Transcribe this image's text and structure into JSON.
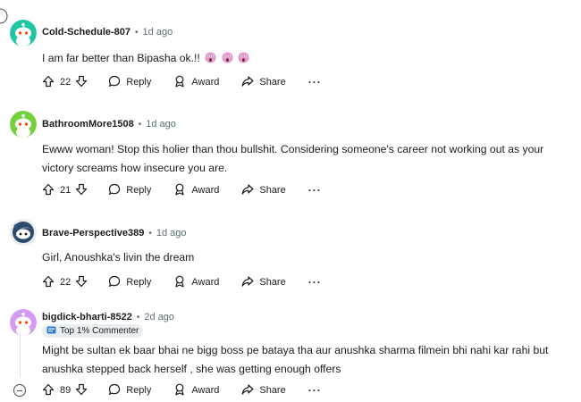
{
  "comments": [
    {
      "username": "Cold-Schedule-807",
      "time": "1d ago",
      "avatar_color": "#1fc6a6",
      "text": "I am far better than Bipasha ok.!!",
      "emojis": [
        "scream-emoji",
        "scream-emoji",
        "scream-emoji"
      ],
      "votes": "22",
      "actions": {
        "reply": "Reply",
        "award": "Award",
        "share": "Share",
        "more": "···"
      }
    },
    {
      "username": "BathroomMore1508",
      "time": "1d ago",
      "avatar_color": "#73d13d",
      "text": "Ewww woman! Stop this holier than thou bullshit. Considering someone's career not working out as your victory screams how insecure you are.",
      "votes": "21",
      "actions": {
        "reply": "Reply",
        "award": "Award",
        "share": "Share",
        "more": "···"
      }
    },
    {
      "username": "Brave-Perspective389",
      "time": "1d ago",
      "avatar_color": "#2b4a6b",
      "text": "Girl, Anoushka's livin the dream",
      "votes": "22",
      "actions": {
        "reply": "Reply",
        "award": "Award",
        "share": "Share",
        "more": "···"
      }
    },
    {
      "username": "bigdick-bharti-8522",
      "time": "2d ago",
      "avatar_color": "#d49bf3",
      "badge": "Top 1% Commenter",
      "text": "Might be sultan ek baar bhai ne bigg boss pe bataya tha aur anushka sharma filmein bhi nahi kar rahi but anushka stepped back herself , she was getting enough offers",
      "votes": "89",
      "actions": {
        "reply": "Reply",
        "award": "Award",
        "share": "Share",
        "more": "···"
      }
    }
  ],
  "separator": "•"
}
